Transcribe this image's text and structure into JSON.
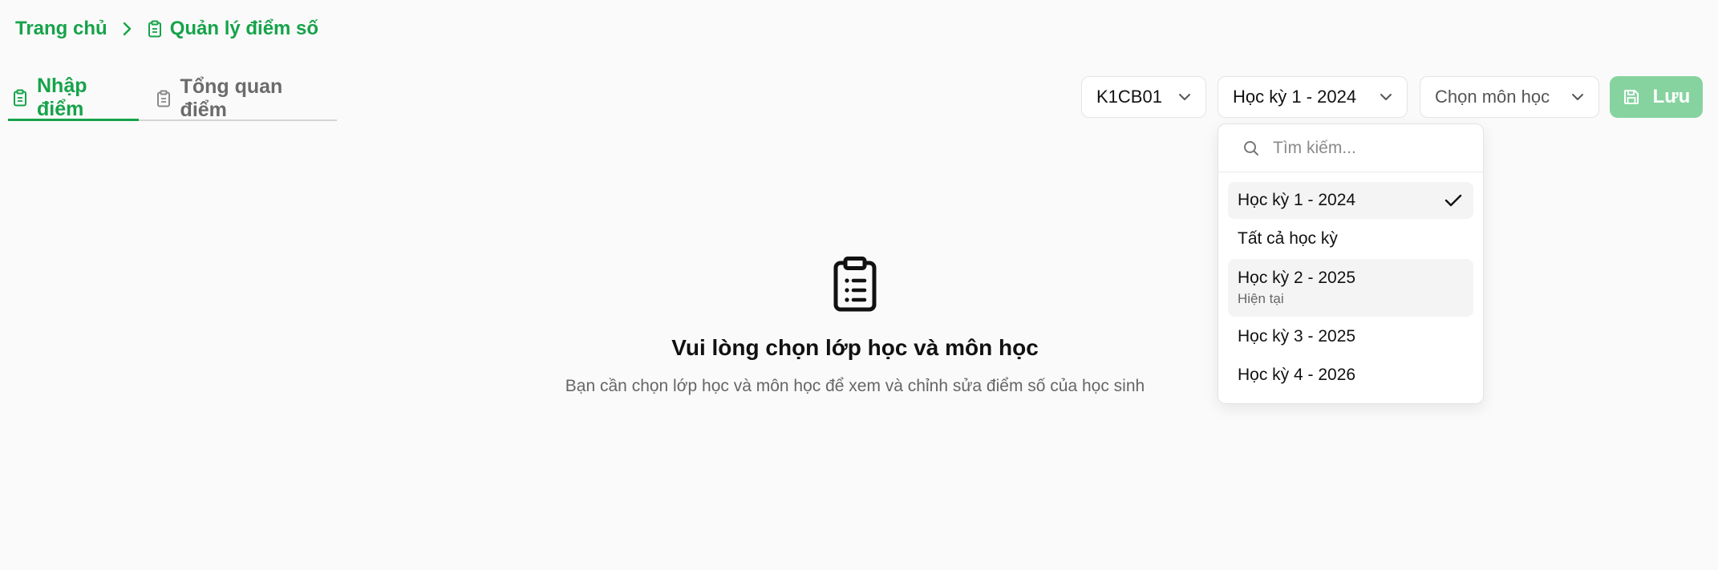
{
  "breadcrumb": {
    "home": "Trang chủ",
    "current": "Quản lý điểm số"
  },
  "tabs": [
    {
      "label": "Nhập điểm",
      "active": true
    },
    {
      "label": "Tổng quan điểm",
      "active": false
    }
  ],
  "toolbar": {
    "class_select": "K1CB01",
    "semester_select": "Học kỳ 1 - 2024",
    "subject_select_placeholder": "Chọn môn học",
    "save_label": "Lưu"
  },
  "dropdown": {
    "search_placeholder": "Tìm kiếm...",
    "items": [
      {
        "label": "Học kỳ 1 - 2024",
        "sub": "",
        "selected": true
      },
      {
        "label": "Tất cả học kỳ",
        "sub": "",
        "selected": false
      },
      {
        "label": "Học kỳ 2 - 2025",
        "sub": "Hiện tại",
        "selected": false
      },
      {
        "label": "Học kỳ 3 - 2025",
        "sub": "",
        "selected": false
      },
      {
        "label": "Học kỳ 4 - 2026",
        "sub": "",
        "selected": false
      }
    ]
  },
  "empty_state": {
    "icon": "clipboard-list-icon",
    "title": "Vui lòng chọn lớp học và môn học",
    "description": "Bạn cần chọn lớp học và môn học để xem và chỉnh sửa điểm số của học sinh"
  },
  "colors": {
    "accent": "#16a34a",
    "save_button_disabled": "#86d3a0",
    "background": "#fafafa"
  }
}
